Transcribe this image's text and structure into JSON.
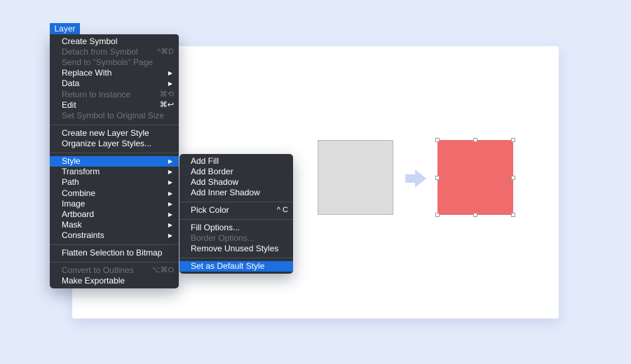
{
  "menu_bar": {
    "layer_label": "Layer"
  },
  "layer_menu": {
    "items": [
      {
        "label": "Create Symbol",
        "shortcut": "",
        "submenu": false,
        "disabled": false
      },
      {
        "label": "Detach from Symbol",
        "shortcut": "^⌘D",
        "submenu": false,
        "disabled": true
      },
      {
        "label": "Send to “Symbols” Page",
        "shortcut": "",
        "submenu": false,
        "disabled": true
      },
      {
        "label": "Replace With",
        "shortcut": "",
        "submenu": true,
        "disabled": false
      },
      {
        "label": "Data",
        "shortcut": "",
        "submenu": true,
        "disabled": false
      },
      {
        "label": "Return to Instance",
        "shortcut": "⌘⟲",
        "submenu": false,
        "disabled": true
      },
      {
        "label": "Edit",
        "shortcut": "⌘↩",
        "submenu": false,
        "disabled": false
      },
      {
        "label": "Set Symbol to Original Size",
        "shortcut": "",
        "submenu": false,
        "disabled": true
      },
      {
        "label": "Create new Layer Style",
        "shortcut": "",
        "submenu": false,
        "disabled": false
      },
      {
        "label": "Organize Layer Styles...",
        "shortcut": "",
        "submenu": false,
        "disabled": false
      },
      {
        "label": "Style",
        "shortcut": "",
        "submenu": true,
        "disabled": false,
        "selected": true
      },
      {
        "label": "Transform",
        "shortcut": "",
        "submenu": true,
        "disabled": false
      },
      {
        "label": "Path",
        "shortcut": "",
        "submenu": true,
        "disabled": false
      },
      {
        "label": "Combine",
        "shortcut": "",
        "submenu": true,
        "disabled": false
      },
      {
        "label": "Image",
        "shortcut": "",
        "submenu": true,
        "disabled": false
      },
      {
        "label": "Artboard",
        "shortcut": "",
        "submenu": true,
        "disabled": false
      },
      {
        "label": "Mask",
        "shortcut": "",
        "submenu": true,
        "disabled": false
      },
      {
        "label": "Constraints",
        "shortcut": "",
        "submenu": true,
        "disabled": false
      },
      {
        "label": "Flatten Selection to Bitmap",
        "shortcut": "",
        "submenu": false,
        "disabled": false
      },
      {
        "label": "Convert to Outlines",
        "shortcut": "⌥⌘O",
        "submenu": false,
        "disabled": true
      },
      {
        "label": "Make Exportable",
        "shortcut": "",
        "submenu": false,
        "disabled": false
      }
    ]
  },
  "style_submenu": {
    "items": [
      {
        "label": "Add Fill",
        "shortcut": "",
        "disabled": false
      },
      {
        "label": "Add Border",
        "shortcut": "",
        "disabled": false
      },
      {
        "label": "Add Shadow",
        "shortcut": "",
        "disabled": false
      },
      {
        "label": "Add Inner Shadow",
        "shortcut": "",
        "disabled": false
      },
      {
        "label": "Pick Color",
        "shortcut": "^ C",
        "disabled": false
      },
      {
        "label": "Fill Options...",
        "shortcut": "",
        "disabled": false
      },
      {
        "label": "Border Options...",
        "shortcut": "",
        "disabled": true
      },
      {
        "label": "Remove Unused Styles",
        "shortcut": "",
        "disabled": false
      },
      {
        "label": "Set as Default Style",
        "shortcut": "",
        "disabled": false,
        "selected": true
      }
    ]
  },
  "colors": {
    "selection_blue": "#1b6fe0",
    "menu_bg": "#2f3238",
    "shape_grey": "#dcdcdc",
    "shape_red": "#f06b6b",
    "arrow": "#c9d6f6"
  },
  "icons": {
    "submenu_arrow": "triangle-right-icon",
    "transform_arrow": "arrow-right-icon"
  }
}
